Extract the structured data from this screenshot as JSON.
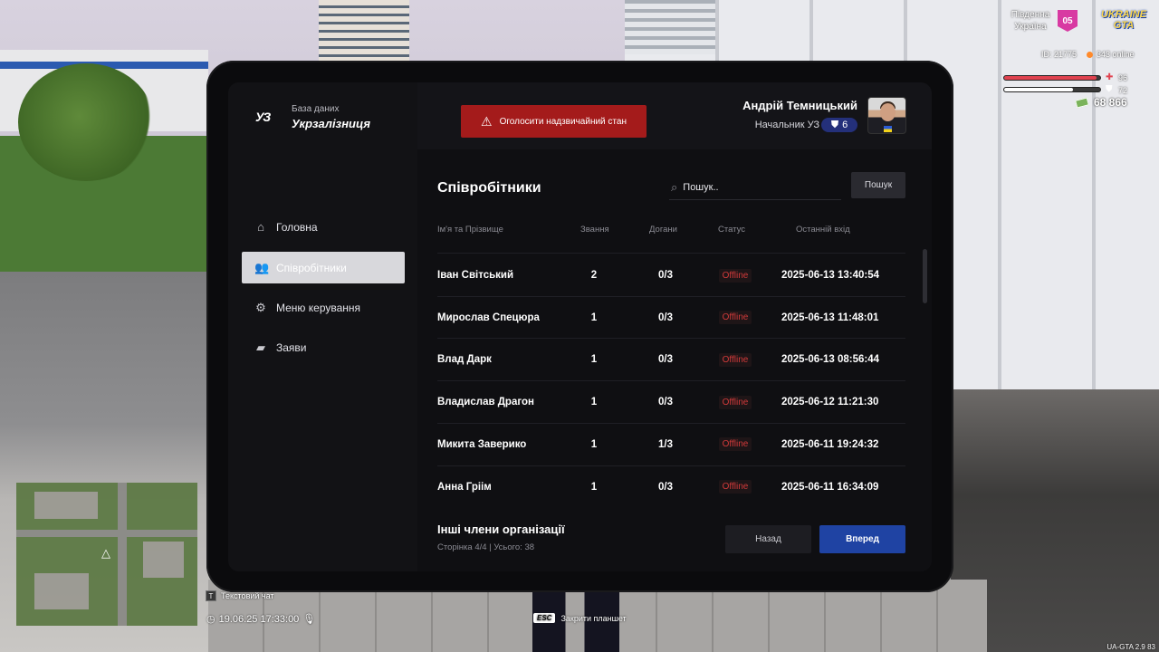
{
  "hud": {
    "region": "Південна Україна",
    "region_num": "05",
    "logo": "UKRAINE GTA",
    "player_id": "ID: 21775",
    "online": "343 online",
    "health": 96,
    "armor": 72,
    "money": "68 866",
    "chat_key": "T",
    "chat_label": "Текстовий чат",
    "datetime": "19.06.25 17:33:00",
    "esc_key": "ESC",
    "esc_label": "Закрити планшет",
    "version": "UA-GTA 2.9   83",
    "colors": {
      "health": "#e0424f",
      "armor": "#ffffff",
      "region_badge": "#d83aa2"
    }
  },
  "tablet": {
    "db_label": "База даних",
    "org_name": "Укрзалізниця",
    "logo_mark": "УЗ",
    "emergency_button": "Оголосити надзвичайний стан",
    "user": {
      "name": "Андрій Темницький",
      "rank_title": "Начальник УЗ",
      "rank_level": "6"
    },
    "nav": [
      {
        "label": "Головна",
        "icon": "home-icon",
        "active": false
      },
      {
        "label": "Співробітники",
        "icon": "users-icon",
        "active": true
      },
      {
        "label": "Меню керування",
        "icon": "gear-icon",
        "active": false
      },
      {
        "label": "Заяви",
        "icon": "folder-icon",
        "active": false
      }
    ],
    "section_title": "Співробітники",
    "search": {
      "placeholder": "Пошук..",
      "button": "Пошук"
    },
    "columns": {
      "name": "Ім'я та Прізвище",
      "rank": "Звання",
      "warnings": "Догани",
      "status": "Статус",
      "last_login": "Останній вхід"
    },
    "employees": [
      {
        "name": "Іван Світський",
        "rank": "2",
        "warnings": "0/3",
        "status": "Offline",
        "last_login": "2025-06-13 13:40:54"
      },
      {
        "name": "Мирослав Спецюра",
        "rank": "1",
        "warnings": "0/3",
        "status": "Offline",
        "last_login": "2025-06-13 11:48:01"
      },
      {
        "name": "Влад Дарк",
        "rank": "1",
        "warnings": "0/3",
        "status": "Offline",
        "last_login": "2025-06-13 08:56:44"
      },
      {
        "name": "Владислав Драгон",
        "rank": "1",
        "warnings": "0/3",
        "status": "Offline",
        "last_login": "2025-06-12 11:21:30"
      },
      {
        "name": "Микита Заверико",
        "rank": "1",
        "warnings": "1/3",
        "status": "Offline",
        "last_login": "2025-06-11 19:24:32"
      },
      {
        "name": "Анна Гріім",
        "rank": "1",
        "warnings": "0/3",
        "status": "Offline",
        "last_login": "2025-06-11 16:34:09"
      }
    ],
    "footer": {
      "title": "Інші члени організації",
      "pagination": "Сторінка 4/4 | Усього: 38",
      "back": "Назад",
      "next": "Вперед"
    },
    "colors": {
      "emergency": "#a41b1b",
      "accent": "#1f43a3",
      "status_offline": "#d23a3a",
      "active_nav": "#d8d8dc"
    }
  }
}
